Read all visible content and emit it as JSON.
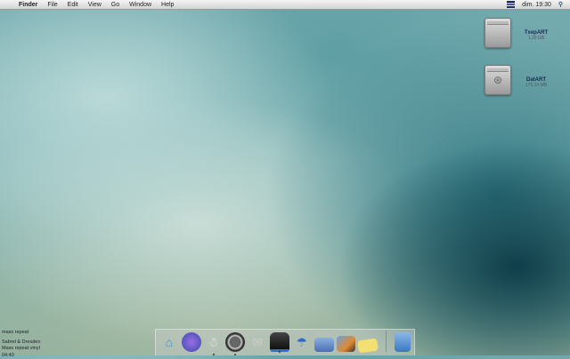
{
  "menubar": {
    "items": [
      "Finder",
      "File",
      "Edit",
      "View",
      "Go",
      "Window",
      "Help"
    ],
    "clock": "dim. 19:30"
  },
  "desktop": {
    "disks": [
      {
        "name": "TxepART",
        "size": "1,09 GB"
      },
      {
        "name": "DatART",
        "size": "176,14 MB"
      }
    ]
  },
  "now_playing": {
    "line1": "mass repeat",
    "line2": "Sabrel & Dresden",
    "line3": "Mass repeat vinyl",
    "time": "04:40"
  },
  "dock": {
    "items": [
      "home",
      "browser",
      "robot",
      "speaker",
      "mail",
      "top-hat",
      "umbrella",
      "bus",
      "photos",
      "notes",
      "trash"
    ]
  }
}
